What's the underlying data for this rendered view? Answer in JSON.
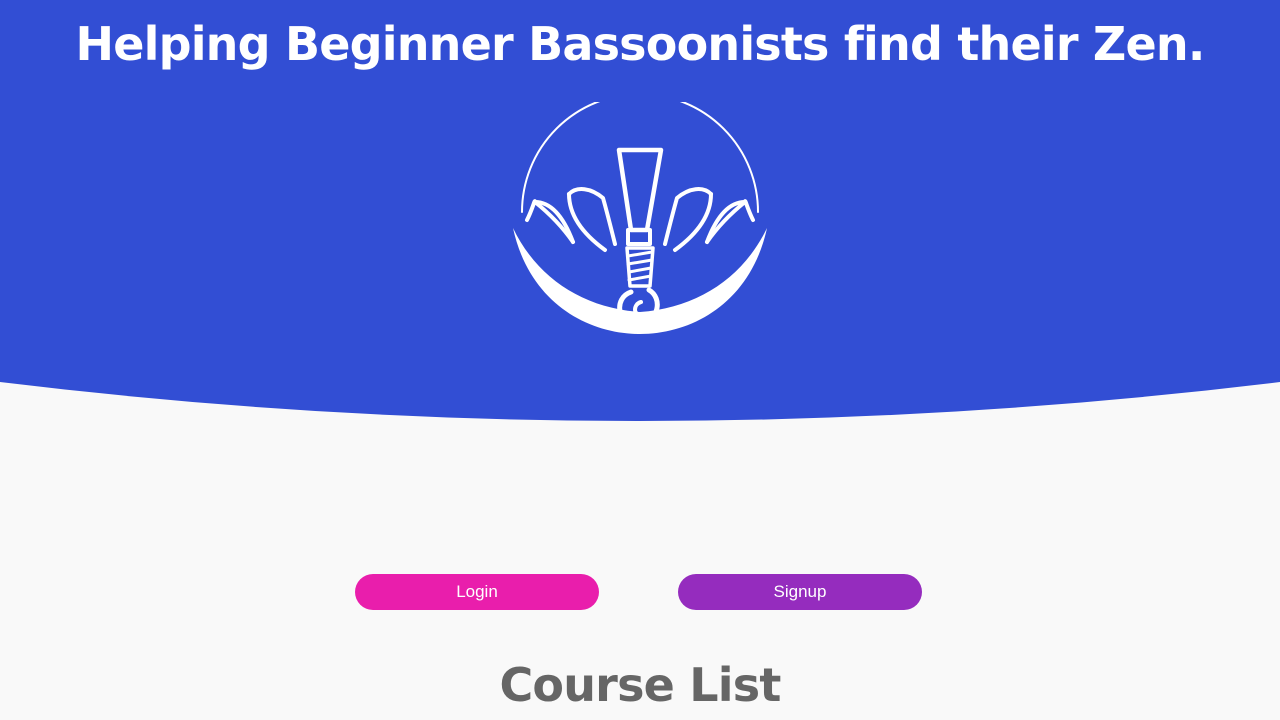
{
  "hero": {
    "title": "Helping Beginner Bassoonists find their Zen.",
    "logo_icon": "lotus-bassoon-reed-icon",
    "background_color": "#324ed4"
  },
  "auth": {
    "login_label": "Login",
    "login_color": "#e91eac",
    "signup_label": "Signup",
    "signup_color": "#952cbe"
  },
  "courses": {
    "title": "Course List"
  },
  "colors": {
    "page_background": "#f9f9f9",
    "heading_gray": "#666666"
  }
}
